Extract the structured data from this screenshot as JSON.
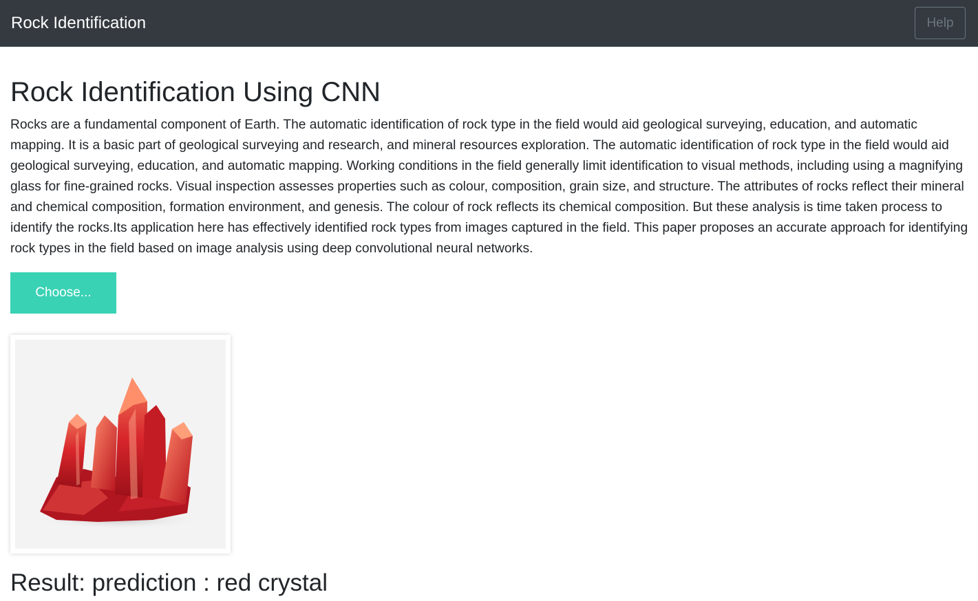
{
  "navbar": {
    "brand": "Rock Identification",
    "help_label": "Help"
  },
  "main": {
    "title": "Rock Identification Using CNN",
    "description": "Rocks are a fundamental component of Earth. The automatic identification of rock type in the field would aid geological surveying, education, and automatic mapping. It is a basic part of geological surveying and research, and mineral resources exploration. The automatic identification of rock type in the field would aid geological surveying, education, and automatic mapping. Working conditions in the field generally limit identification to visual methods, including using a magnifying glass for fine-grained rocks. Visual inspection assesses properties such as colour, composition, grain size, and structure. The attributes of rocks reflect their mineral and chemical composition, formation environment, and genesis. The colour of rock reflects its chemical composition. But these analysis is time taken process to identify the rocks.Its application here has effectively identified rock types from images captured in the field. This paper proposes an accurate approach for identifying rock types in the field based on image analysis using deep convolutional neural networks.",
    "choose_label": "Choose...",
    "result": "Result: prediction : red crystal"
  },
  "colors": {
    "navbar_bg": "#343a40",
    "choose_bg": "#39d2b4",
    "help_border": "#6c757d"
  }
}
